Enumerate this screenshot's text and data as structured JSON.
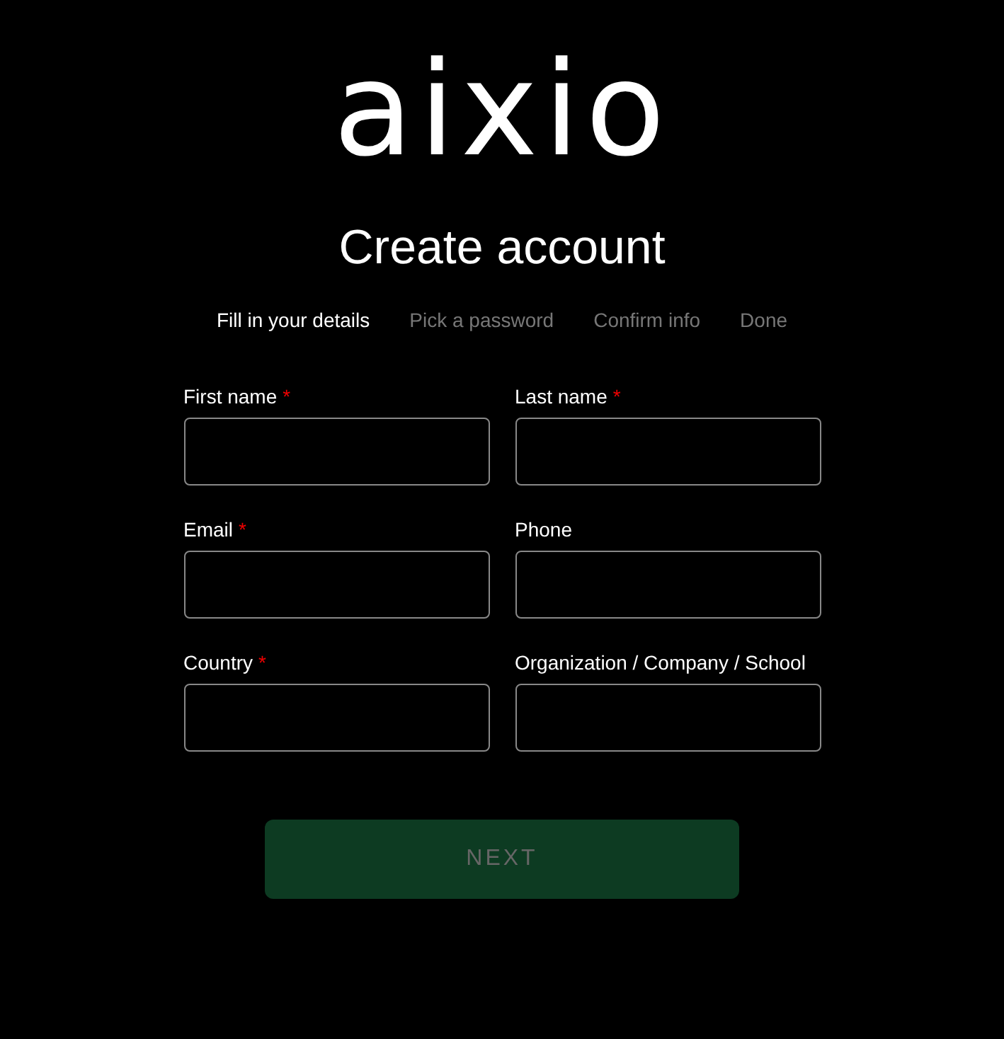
{
  "logo": "aixio",
  "title": "Create account",
  "steps": [
    {
      "label": "Fill in your details",
      "selected": true
    },
    {
      "label": "Pick a password",
      "selected": false
    },
    {
      "label": "Confirm info",
      "selected": false
    },
    {
      "label": "Done",
      "selected": false
    }
  ],
  "required_mark": "*",
  "fields": [
    {
      "label": "First name",
      "required": true
    },
    {
      "label": "Last name",
      "required": true
    },
    {
      "label": "Email",
      "required": true
    },
    {
      "label": "Phone",
      "required": false
    },
    {
      "label": "Country",
      "required": true
    },
    {
      "label": "Organization / Company / School",
      "required": false
    }
  ],
  "next_button": {
    "label": "NEXT",
    "disabled": true
  }
}
